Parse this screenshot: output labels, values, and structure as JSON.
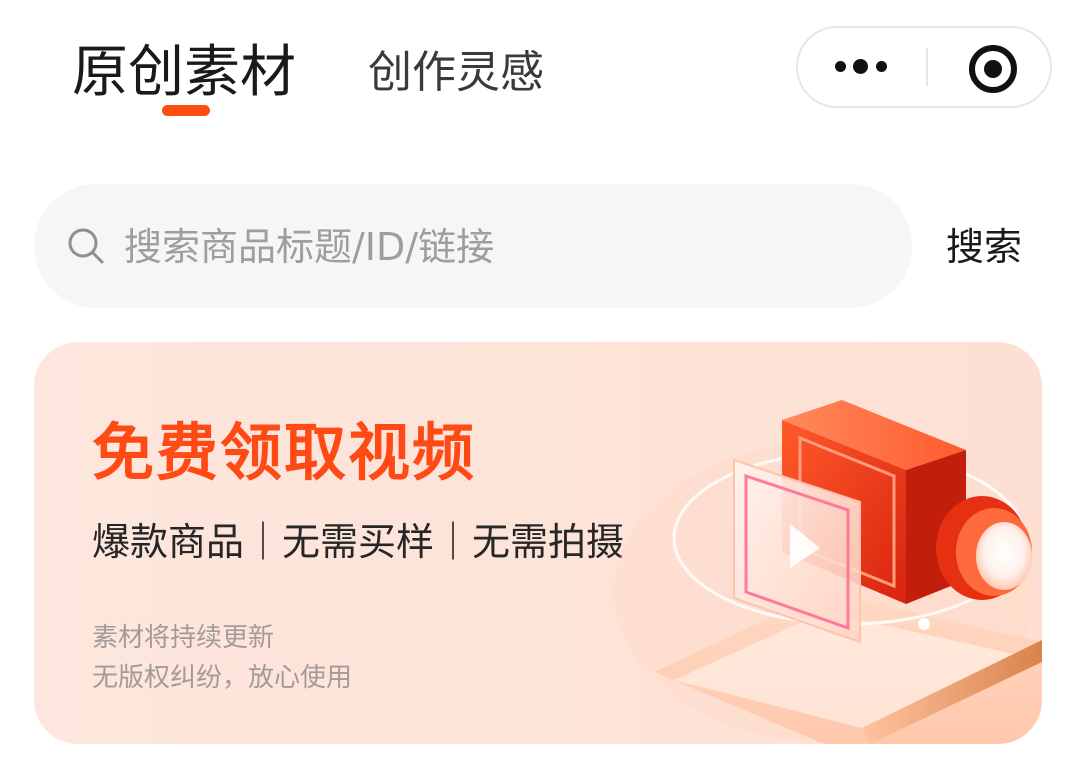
{
  "header": {
    "tabs": [
      {
        "label": "原创素材",
        "active": true
      },
      {
        "label": "创作灵感",
        "active": false
      }
    ],
    "capsule": {
      "more_icon": "more-dots-icon",
      "close_icon": "target-close-icon"
    }
  },
  "search": {
    "icon": "search-icon",
    "placeholder": "搜索商品标题/ID/链接",
    "button_label": "搜索"
  },
  "banner": {
    "title": "免费领取视频",
    "subtitle": "爆款商品｜无需买样｜无需拍摄",
    "notes": [
      "素材将持续更新",
      "无版权纠纷，放心使用"
    ],
    "illustration": "video-camera-illustration"
  },
  "colors": {
    "accent": "#ff4d12",
    "banner_title": "#ff4a16",
    "banner_bg": "#fde4d9",
    "search_bg": "#f6f6f6",
    "placeholder": "#9e9e9e"
  }
}
